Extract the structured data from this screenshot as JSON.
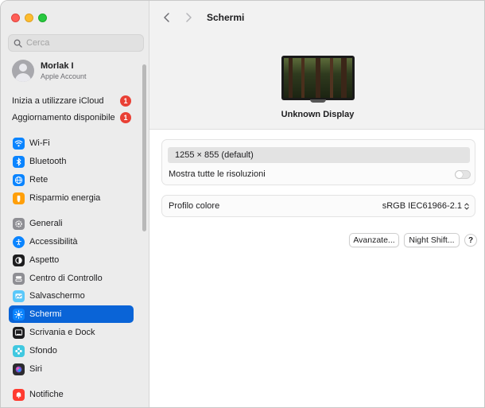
{
  "window": {
    "title": "Schermi"
  },
  "sidebar": {
    "search": {
      "placeholder": "Cerca",
      "value": ""
    },
    "account": {
      "name": "Morlak I",
      "subtitle": "Apple Account"
    },
    "notifications": [
      {
        "label": "Inizia a utilizzare iCloud",
        "badge": "1"
      },
      {
        "label": "Aggiornamento disponibile",
        "badge": "1"
      }
    ],
    "items": [
      {
        "label": "Wi-Fi",
        "icon": "wifi-icon",
        "color": "#0a84ff"
      },
      {
        "label": "Bluetooth",
        "icon": "bluetooth-icon",
        "color": "#0a84ff"
      },
      {
        "label": "Rete",
        "icon": "globe-icon",
        "color": "#0a84ff"
      },
      {
        "label": "Risparmio energia",
        "icon": "battery-icon",
        "color": "#ff9f0a"
      },
      {
        "label": "Generali",
        "icon": "gear-icon",
        "color": "#8e8e93"
      },
      {
        "label": "Accessibilità",
        "icon": "accessibility-icon",
        "color": "#0a84ff"
      },
      {
        "label": "Aspetto",
        "icon": "appearance-icon",
        "color": "#1d1d1f"
      },
      {
        "label": "Centro di Controllo",
        "icon": "control-center-icon",
        "color": "#8e8e93"
      },
      {
        "label": "Salvaschermo",
        "icon": "screensaver-icon",
        "color": "#5ac8fa"
      },
      {
        "label": "Schermi",
        "icon": "sun-icon",
        "color": "#0a84ff",
        "selected": true
      },
      {
        "label": "Scrivania e Dock",
        "icon": "dock-icon",
        "color": "#1d1d1f"
      },
      {
        "label": "Sfondo",
        "icon": "wallpaper-icon",
        "color": "#40c8e0"
      },
      {
        "label": "Siri",
        "icon": "siri-icon",
        "color": "#2c2c2e"
      },
      {
        "label": "Notifiche",
        "icon": "bell-icon",
        "color": "#ff3b30"
      }
    ]
  },
  "main": {
    "title": "Schermi",
    "display_name": "Unknown Display",
    "resolution": "1255 × 855 (default)",
    "show_all_label": "Mostra tutte le risoluzioni",
    "show_all_enabled": false,
    "color_profile_label": "Profilo colore",
    "color_profile_value": "sRGB IEC61966-2.1",
    "buttons": {
      "advanced": "Avanzate...",
      "night_shift": "Night Shift...",
      "help": "?"
    }
  }
}
